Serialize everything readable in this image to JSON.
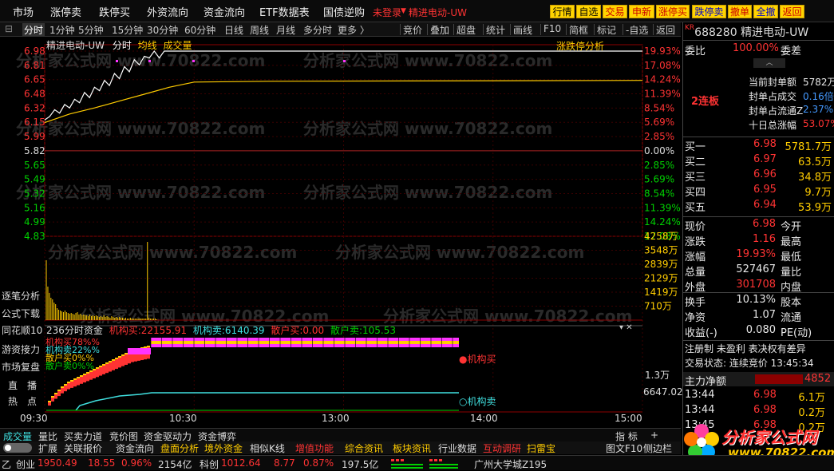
{
  "menu": [
    "市场",
    "涨停卖",
    "跌停买",
    "外资流向",
    "资金流向",
    "ETF数据表",
    "国债逆购"
  ],
  "menu_status": "未登录",
  "menu_stock": "精进电动-UW",
  "right_buttons": [
    {
      "label": "行情",
      "bg": "#ffd400",
      "fg": "#000"
    },
    {
      "label": "自选",
      "bg": "#ffd400",
      "fg": "#000"
    },
    {
      "label": "交易",
      "bg": "#ffd400",
      "fg": "#cc0000"
    },
    {
      "label": "申新",
      "bg": "#ffd400",
      "fg": "#cc0000"
    },
    {
      "label": "涨停买",
      "bg": "#ffd400",
      "fg": "#cc0000"
    },
    {
      "label": "跌停卖",
      "bg": "#ffd400",
      "fg": "#0000cc"
    },
    {
      "label": "撤单",
      "bg": "#ffd400",
      "fg": "#cc0000"
    },
    {
      "label": "全撤",
      "bg": "#ffd400",
      "fg": "#0000cc"
    },
    {
      "label": "返回",
      "bg": "#ffd400",
      "fg": "#cc0000"
    }
  ],
  "periods": [
    "分时",
    "1分钟",
    "5分钟",
    "15分钟",
    "30分钟",
    "60分钟",
    "日线",
    "周线",
    "月线",
    "多分时",
    "更多 〉"
  ],
  "tools": [
    "竞价",
    "叠加",
    "超盘",
    "统计",
    "画线",
    "F10",
    "简框",
    "标记",
    "-自选",
    "返回"
  ],
  "chart": {
    "stock_title": "精进电动-UW",
    "tab_fenshi": "分时",
    "tab_avg": "均线",
    "tab_vol": "成交量",
    "limit_analysis": "涨跌停分析",
    "price_ticks": [
      "6.98",
      "6.81",
      "6.65",
      "6.48",
      "6.32",
      "6.15",
      "5.99",
      "5.82",
      "5.65",
      "5.49",
      "5.32",
      "5.16",
      "4.99",
      "4.83"
    ],
    "pct_ticks": [
      "19.93%",
      "17.08%",
      "14.24%",
      "11.39%",
      "8.54%",
      "5.69%",
      "2.85%",
      "0.00%",
      "2.85%",
      "5.69%",
      "8.54%",
      "11.39%",
      "14.24%",
      "17.08%"
    ],
    "vol_ticks": [
      "4258万",
      "3548万",
      "2839万",
      "2129万",
      "1419万",
      "710万"
    ],
    "fund_label": "236分时资金",
    "fund_buy_label": "机构买:",
    "fund_buy": "22155.91",
    "fund_sell_label": "机构卖:",
    "fund_sell": "6140.39",
    "retail_buy_label": "散户买:",
    "retail_buy": "0.00",
    "retail_sell_label": "散户卖:",
    "retail_sell": "105.53",
    "legend1": "机构买78%%",
    "legend2": "机构卖22%%",
    "legend3": "散户买0%%",
    "legend4": "散户卖0%%",
    "marker_buy": "●机构买",
    "marker_sell": "○机构卖",
    "fund_ticks": [
      "1.3万",
      "6647.02"
    ],
    "time_ticks": [
      "09:30",
      "10:30",
      "13:00",
      "14:00",
      "15:00"
    ]
  },
  "chart_data": {
    "type": "line",
    "price_series": [
      {
        "t": 0,
        "v": 6.18
      },
      {
        "t": 2,
        "v": 6.22
      },
      {
        "t": 4,
        "v": 6.3
      },
      {
        "t": 6,
        "v": 6.26
      },
      {
        "t": 8,
        "v": 6.36
      },
      {
        "t": 10,
        "v": 6.32
      },
      {
        "t": 12,
        "v": 6.42
      },
      {
        "t": 14,
        "v": 6.38
      },
      {
        "t": 16,
        "v": 6.5
      },
      {
        "t": 18,
        "v": 6.44
      },
      {
        "t": 20,
        "v": 6.56
      },
      {
        "t": 22,
        "v": 6.52
      },
      {
        "t": 24,
        "v": 6.64
      },
      {
        "t": 26,
        "v": 6.58
      },
      {
        "t": 28,
        "v": 6.72
      },
      {
        "t": 30,
        "v": 6.66
      },
      {
        "t": 32,
        "v": 6.8
      },
      {
        "t": 34,
        "v": 6.74
      },
      {
        "t": 36,
        "v": 6.88
      },
      {
        "t": 38,
        "v": 6.82
      },
      {
        "t": 40,
        "v": 6.92
      },
      {
        "t": 42,
        "v": 6.9
      },
      {
        "t": 44,
        "v": 6.98
      },
      {
        "t": 46,
        "v": 6.9
      },
      {
        "t": 48,
        "v": 6.98
      },
      {
        "t": 240,
        "v": 6.98
      }
    ],
    "avg_series": [
      {
        "t": 0,
        "v": 6.15
      },
      {
        "t": 10,
        "v": 6.25
      },
      {
        "t": 20,
        "v": 6.32
      },
      {
        "t": 30,
        "v": 6.4
      },
      {
        "t": 40,
        "v": 6.48
      },
      {
        "t": 50,
        "v": 6.56
      },
      {
        "t": 60,
        "v": 6.62
      },
      {
        "t": 90,
        "v": 6.63
      },
      {
        "t": 240,
        "v": 6.64
      }
    ],
    "ylim": [
      4.83,
      6.98
    ],
    "xlim": [
      0,
      240
    ],
    "grid": true
  },
  "sidebar": [
    "逐笔分析",
    "公式下载",
    "同花顺10",
    "游资接力",
    "市场复盘",
    "直　播",
    "热　点"
  ],
  "right": {
    "market_tag": "KR",
    "code": "688280",
    "name": "精进电动-UW",
    "weibi_label": "委比",
    "weibi": "100.00%",
    "weicha_label": "委差",
    "board": "2连板",
    "seal": [
      {
        "label": "当前封单额",
        "value": "5782万"
      },
      {
        "label": "封单占成交",
        "value": "0.16倍"
      },
      {
        "label": "封单占流通Z",
        "value": "2.37%"
      },
      {
        "label": "十日总涨幅",
        "value": "53.07%"
      }
    ],
    "bids": [
      {
        "label": "买一",
        "price": "6.98",
        "vol": "5781.7万"
      },
      {
        "label": "买二",
        "price": "6.97",
        "vol": "63.5万"
      },
      {
        "label": "买三",
        "price": "6.96",
        "vol": "34.8万"
      },
      {
        "label": "买四",
        "price": "6.95",
        "vol": "9.7万"
      },
      {
        "label": "买五",
        "price": "6.94",
        "vol": "53.9万"
      }
    ],
    "quote": [
      {
        "l1": "现价",
        "v1": "6.98",
        "c1": "red",
        "l2": "今开",
        "v2": "",
        "c2": "wht"
      },
      {
        "l1": "涨跌",
        "v1": "1.16",
        "c1": "red",
        "l2": "最高",
        "v2": "",
        "c2": "wht"
      },
      {
        "l1": "涨幅",
        "v1": "19.93%",
        "c1": "red",
        "l2": "最低",
        "v2": "",
        "c2": "wht"
      },
      {
        "l1": "总量",
        "v1": "527467",
        "c1": "wht",
        "l2": "量比",
        "v2": "",
        "c2": "wht"
      },
      {
        "l1": "外盘",
        "v1": "301708",
        "c1": "red",
        "l2": "内盘",
        "v2": "",
        "c2": "wht"
      }
    ],
    "stats": [
      {
        "l1": "换手",
        "v1": "10.13%",
        "l2": "股本"
      },
      {
        "l1": "净资",
        "v1": "1.07",
        "l2": "流通"
      },
      {
        "l1": "收益(-)",
        "v1": "0.080",
        "l2": "PE(动)"
      }
    ],
    "reg_line": "注册制 未盈利 表决权有差异",
    "trade_status": "交易状态: 连续竞价 13:45:34",
    "net_label": "主力净额",
    "net_value": "4852",
    "ticks": [
      {
        "time": "13:44",
        "price": "6.98",
        "vol": "6.1万"
      },
      {
        "time": "13:44",
        "price": "6.98",
        "vol": "0.2万"
      },
      {
        "time": "13:45",
        "price": "6.98",
        "vol": "0.2万"
      }
    ],
    "logo_text": "分析家公式网",
    "logo_url": "www.70822.com"
  },
  "bottom_tabs": [
    "成交量",
    "量比",
    "买卖力道",
    "竞价图",
    "资金驱动力",
    "资金博弈"
  ],
  "bottom_right": [
    "指 标",
    "+"
  ],
  "tabbar": [
    {
      "t": "扩展",
      "c": "#ddd"
    },
    {
      "t": "关联报价",
      "c": "#ddd"
    },
    {
      "t": "资金流向",
      "c": "#ddd"
    },
    {
      "t": "盘面分析",
      "c": "#ffcc00"
    },
    {
      "t": "境外资金",
      "c": "#ffcc00"
    },
    {
      "t": "相似K线",
      "c": "#ddd"
    },
    {
      "t": "增值功能",
      "c": "#ff3333"
    },
    {
      "t": "综合资讯",
      "c": "#ffcc00"
    },
    {
      "t": "板块资讯",
      "c": "#ffcc00"
    },
    {
      "t": "行业数据",
      "c": "#ddd"
    },
    {
      "t": "互动调研",
      "c": "#ff3333"
    },
    {
      "t": "扫雷宝",
      "c": "#ffcc00"
    }
  ],
  "tabbar_right": [
    "图文F10",
    "侧边栏"
  ],
  "status": {
    "prefix": "乙",
    "market1": "创业",
    "v1": "1950.49",
    "c1": "18.55",
    "p1": "0.96%",
    "a1": "2154亿",
    "market2": "科创",
    "v2": "1012.64",
    "c2": "8.77",
    "p2": "0.87%",
    "a2": "197.5亿",
    "news": "广州大学城Z195"
  },
  "watermark": "分析家公式网 www.70822.com"
}
